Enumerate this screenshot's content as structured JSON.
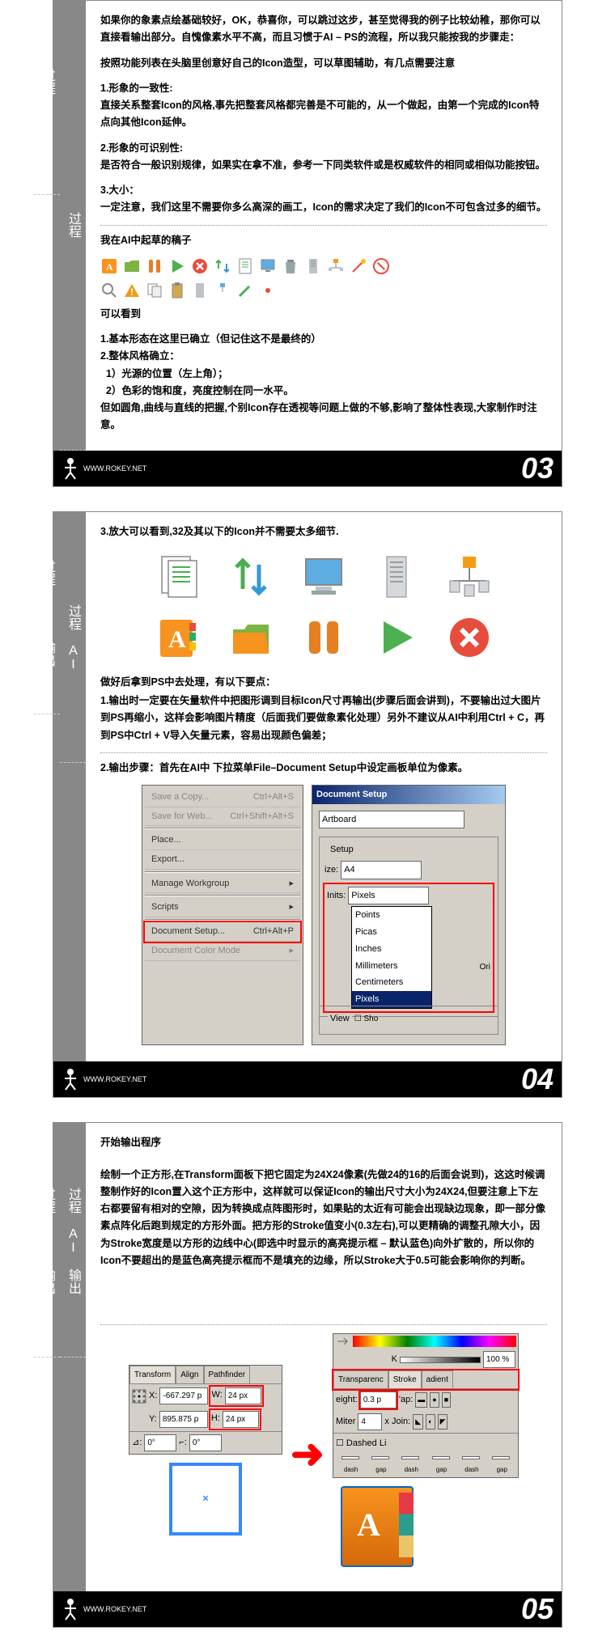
{
  "page03": {
    "sidebar": {
      "s1": "过程",
      "s2": "过程 AI"
    },
    "p1": "如果你的象素点绘基础较好，OK，恭喜你，可以跳过这步，甚至觉得我的例子比较幼稚，那你可以直接看输出部分。自愧像素水平不高，而且习惯于AI – PS的流程，所以我只能按我的步骤走：",
    "p2": "按照功能列表在头脑里创意好自己的Icon造型，可以草图辅助，有几点需要注意",
    "h1": "1.形象的一致性:",
    "p3": "直接关系整套Icon的风格,事先把整套风格都完善是不可能的，从一个做起，由第一个完成的Icon特点向其他Icon延伸。",
    "h2": "2.形象的可识别性:",
    "p4": "是否符合一般识别规律，如果实在拿不准，参考一下同类软件或是权威软件的相同或相似功能按钮。",
    "h3": "3.大小：",
    "p5": "一定注意，我们这里不需要你多么高深的画工，Icon的需求决定了我们的Icon不可包含过多的细节。",
    "draft_title": "我在AI中起草的稿子",
    "observe": "可以看到",
    "obs1": "1.基本形态在这里已确立（但记住这不是最终的）",
    "obs2": "2.整体风格确立：",
    "obs2a": "  1）光源的位置（左上角）；",
    "obs2b": "  2）色彩的饱和度，亮度控制在同一水平。",
    "obs3": "但如圆角,曲线与直线的把握,个别Icon存在透视等问题上做的不够,影响了整体性表现,大家制作时注意。",
    "footer_url": "WWW.ROKEY.NET",
    "num": "03"
  },
  "page04": {
    "sidebar": {
      "s1": "过程 AI",
      "s2": "过程 AI 输出"
    },
    "p1": "3.放大可以看到,32及其以下的Icon并不需要太多细节.",
    "p2": "做好后拿到PS中去处理，有以下要点：",
    "p3": "1.输出时一定要在矢量软件中把图形调到目标Icon尺寸再输出(步骤后面会讲到)，不要输出过大图片到PS再缩小，这样会影响图片精度（后面我们要做象素化处理）另外不建议从AI中利用Ctrl + C，再到PS中Ctrl + V导入矢量元素，容易出现颜色偏差；",
    "p4": "2.输出步骤：首先在AI中 下拉菜单File–Document Setup中设定画板单位为像素。",
    "menu": {
      "save_copy": "Save a Copy...",
      "save_copy_key": "Ctrl+Alt+S",
      "save_web": "Save for Web...",
      "save_web_key": "Ctrl+Shift+Alt+S",
      "place": "Place...",
      "export": "Export...",
      "workgroup": "Manage Workgroup",
      "scripts": "Scripts",
      "doc_setup": "Document Setup...",
      "doc_setup_key": "Ctrl+Alt+P",
      "color_mode": "Document Color Mode"
    },
    "setup": {
      "title": "Document Setup",
      "artboard": "Artboard",
      "setup_label": "Setup",
      "size_label": "ize:",
      "size_val": "A4",
      "units_label": "Inits:",
      "units_val": "Pixels",
      "points": "Points",
      "picas": "Picas",
      "inches": "Inches",
      "mm": "Millimeters",
      "cm": "Centimeters",
      "px": "Pixels",
      "view": "View",
      "sho": "Sho",
      "ori": "Ori"
    },
    "footer_url": "WWW.ROKEY.NET",
    "num": "04"
  },
  "page05": {
    "sidebar": {
      "s1": "过程 AI 输出",
      "s2": "过程 AI 输出"
    },
    "h1": "开始输出程序",
    "p1": "绘制一个正方形,在Transform面板下把它固定为24X24像素(先做24的16的后面会说到)，这这时候调整制作好的Icon置入这个正方形中，这样就可以保证Icon的输出尺寸大小为24X24,但要注意上下左右都要留有相对的空隙，因为转换成点阵图形时，如果贴的太近有可能会出现缺边现象，即一部分像素点阵化后跑到规定的方形外面。把方形的Stroke值变小(0.3左右),可以更精确的调整孔隙大小，因为Stroke宽度是以方形的边线中心(即选中时显示的高亮提示框 – 默认蓝色)向外扩散的，所以你的Icon不要超出的是蓝色高亮提示框而不是填充的边缘，所以Stroke大于0.5可能会影响你的判断。",
    "transform": {
      "tab1": "Transform",
      "tab2": "Align",
      "tab3": "Pathfinder",
      "x_label": "X:",
      "x_val": "-667.297 p",
      "y_label": "Y:",
      "895.875 p": "895.875 p",
      "y_val": "895.875 p",
      "w_label": "W:",
      "w_val": "24 px",
      "h_label": "H:",
      "h_val": "24 px",
      "angle": "0°",
      "shear": "0°"
    },
    "stroke": {
      "k_label": "K",
      "pct": "100 %",
      "tab1": "Transparenc",
      "tab2": "Stroke",
      "tab3": "adient",
      "weight": "eight:",
      "weight_val": "0.3 p",
      "cap": "'ap:",
      "miter": "Miter",
      "miter_val": "4",
      "join": "x Join:",
      "dashed": "Dashed Li",
      "dash": "dash",
      "gap": "gap"
    },
    "footer_url": "WWW.ROKEY.NET",
    "num": "05"
  }
}
